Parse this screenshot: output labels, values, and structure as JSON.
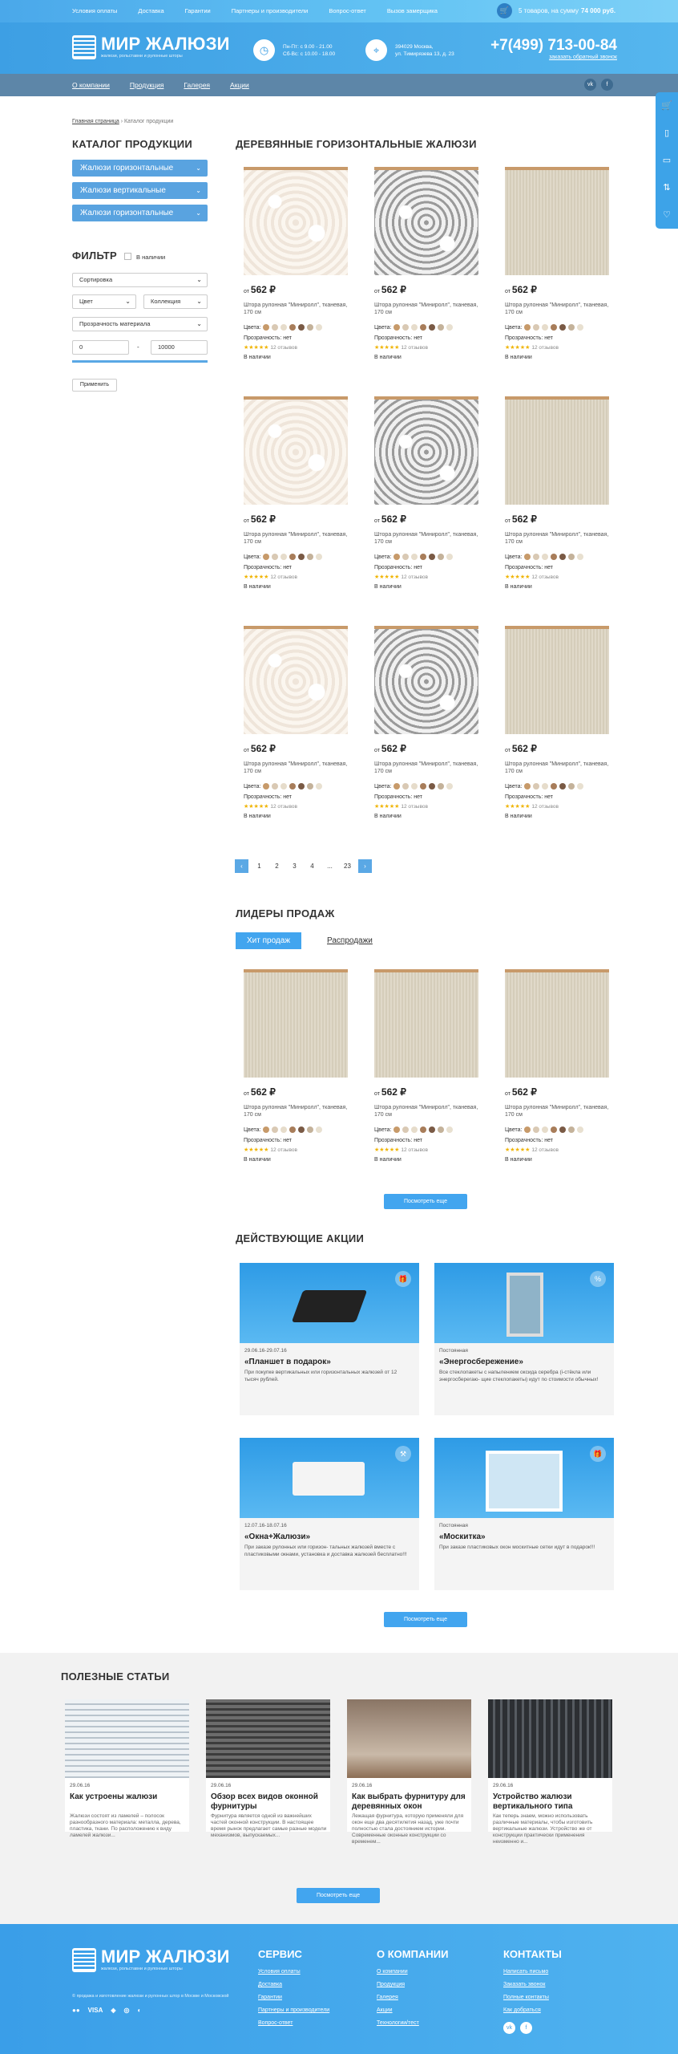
{
  "top_links": [
    "Условия оплаты",
    "Доставка",
    "Гарантии",
    "Партнеры и производители",
    "Вопрос-ответ",
    "Вызов замерщика"
  ],
  "cart": {
    "prefix": "5 товаров, на сумму",
    "sum": "74 000 руб."
  },
  "brand": {
    "name": "МИР ЖАЛЮЗИ",
    "tagline": "жалюзи, рольставни и рулонные шторы"
  },
  "hours": {
    "l1": "Пн-Пт: с 9.00 - 21.00",
    "l2": "Сб-Вс: с 10.00 - 18.00"
  },
  "address": {
    "l1": "394029 Москва,",
    "l2": "ул. Тимирязева 13, д. 23"
  },
  "phone": {
    "number": "+7(499) 713-00-84",
    "callback": "заказать обратный звонок"
  },
  "nav": [
    "О компании",
    "Продукция",
    "Галерея",
    "Акции"
  ],
  "social": {
    "vk": "vk",
    "fb": "f"
  },
  "breadcrumb": {
    "home": "Главная страница",
    "sep": "›",
    "current": "Каталог продукции"
  },
  "catalog": {
    "title": "КАТАЛОГ ПРОДУКЦИИ",
    "items": [
      "Жалюзи горизонтальные",
      "Жалюзи вертикальные",
      "Жалюзи горизонтальные"
    ]
  },
  "filter": {
    "title": "ФИЛЬТР",
    "in_stock": "В наличии",
    "sort": "Сортировка",
    "color": "Цвет",
    "collection": "Коллекция",
    "transparency": "Прозрачность материала",
    "min": "0",
    "dash": "-",
    "max": "10000",
    "apply": "Применить"
  },
  "section_title": "ДЕРЕВЯННЫЕ ГОРИЗОНТАЛЬНЫЕ ЖАЛЮЗИ",
  "product": {
    "from": "от",
    "price": "562 ₽",
    "name": "Штора рулонная \"Миниролл\", тканевая, 170 см",
    "colors_label": "Цвета:",
    "transparency": "Прозрачность: нет",
    "stars": "★★★★★",
    "reviews": "12 отзывов",
    "availability": "В наличии"
  },
  "pagination": [
    "‹",
    "1",
    "2",
    "3",
    "4",
    "...",
    "23",
    "›"
  ],
  "leaders": {
    "title": "ЛИДЕРЫ ПРОДАЖ",
    "tab_hit": "Хит продаж",
    "tab_sale": "Распродажи",
    "more": "Посмотреть еще"
  },
  "promos": {
    "title": "ДЕЙСТВУЮЩИЕ АКЦИИ",
    "more": "Посмотреть еще",
    "items": [
      {
        "date": "29.06.16-29.07.16",
        "title": "«Планшет в подарок»",
        "text": "При покупке вертикальных или горизонтальных жалюзей от 12 тысяч рублей."
      },
      {
        "date": "Постоянная",
        "title": "«Энергосбережение»",
        "text": "Все стеклопакеты с напылением оксида серебра (i-стёкла или энергосберегаю- щие стеклопакеты) идут по стоимости обычных!"
      },
      {
        "date": "12.07.16-18.07.16",
        "title": "«Окна+Жалюзи»",
        "text": "При заказе рулонных или горизон- тальных жалюзей вместе с пластиковыми окнами, установка и доставка жалюзей бесплатно!!!"
      },
      {
        "date": "Постоянная",
        "title": "«Москитка»",
        "text": "При заказе пластиковых окон москитные сетки идут в подарок!!!"
      }
    ]
  },
  "articles": {
    "title": "ПОЛЕЗНЫЕ СТАТЬИ",
    "more": "Посмотреть еще",
    "items": [
      {
        "date": "29.06.16",
        "title": "Как устроены жалюзи",
        "text": "Жалюзи состоят из ламелей – полосок разнообразного материала: металла, дерева, пластика, ткани. По расположению к виду ламелей жалюзи..."
      },
      {
        "date": "29.06.16",
        "title": "Обзор всех видов оконной фурнитуры",
        "text": "Фурнитура является одной из важнейших частей оконной конструкции. В настоящее время рынок предлагает самые разные модели механизмов, выпускаемых..."
      },
      {
        "date": "29.06.16",
        "title": "Как выбрать фурнитуру для деревянных окон",
        "text": "Лежащая фурнитура, которую применяли для окон еще два десятилетия назад, уже почти полностью стала достоянием истории. Современные оконные конструкции со временем..."
      },
      {
        "date": "29.06.16",
        "title": "Устройство жалюзи вертикального типа",
        "text": "Как теперь знаем, можно использовать различные материалы, чтобы изготовить вертикальные жалюзи. Устройство же от конструкции практически применения неизменно и..."
      }
    ]
  },
  "footer": {
    "service_title": "СЕРВИС",
    "service": [
      "Условия оплаты",
      "Доставка",
      "Гарантии",
      "Партнеры и производители",
      "Вопрос-ответ"
    ],
    "company_title": "О КОМПАНИИ",
    "company": [
      "О компании",
      "Продукция",
      "Галерея",
      "Акции",
      "Технологии/тест"
    ],
    "contacts_title": "КОНТАКТЫ",
    "contacts": [
      "Написать письмо",
      "Заказать звонок",
      "Полные контакты",
      "Как добраться"
    ],
    "copy": "© продажа и изготовление жалюзи и рулонных штор в Москве и Московской"
  },
  "colors": {
    "accent": "#42a5ef",
    "nav": "#5d86a8",
    "swatches": [
      "#c79a6a",
      "#d9c9b4",
      "#e6dccb",
      "#a87d5a",
      "#7a5a45",
      "#c4b29a",
      "#e8e0d0"
    ]
  }
}
